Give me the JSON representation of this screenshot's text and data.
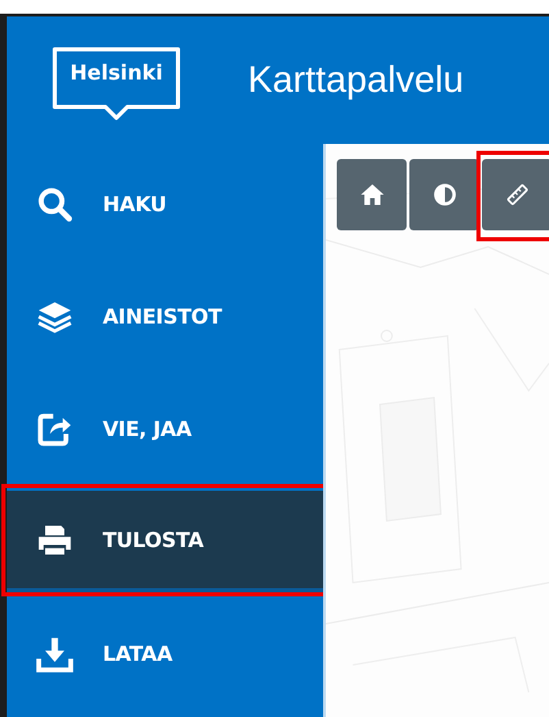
{
  "header": {
    "logo": "Helsinki",
    "title": "Karttapalvelu"
  },
  "sidebar": {
    "items": [
      {
        "kind": "search",
        "label": "HAKU",
        "selected": false,
        "highlighted": false
      },
      {
        "kind": "layers",
        "label": "AINEISTOT",
        "selected": false,
        "highlighted": false
      },
      {
        "kind": "share",
        "label": "VIE, JAA",
        "selected": false,
        "highlighted": false
      },
      {
        "kind": "print",
        "label": "TULOSTA",
        "selected": true,
        "highlighted": true
      },
      {
        "kind": "download",
        "label": "LATAA",
        "selected": false,
        "highlighted": false
      }
    ]
  },
  "map": {
    "tools": [
      {
        "kind": "home",
        "highlighted": false
      },
      {
        "kind": "contrast",
        "highlighted": false
      },
      {
        "kind": "measure",
        "highlighted": true
      }
    ]
  }
}
